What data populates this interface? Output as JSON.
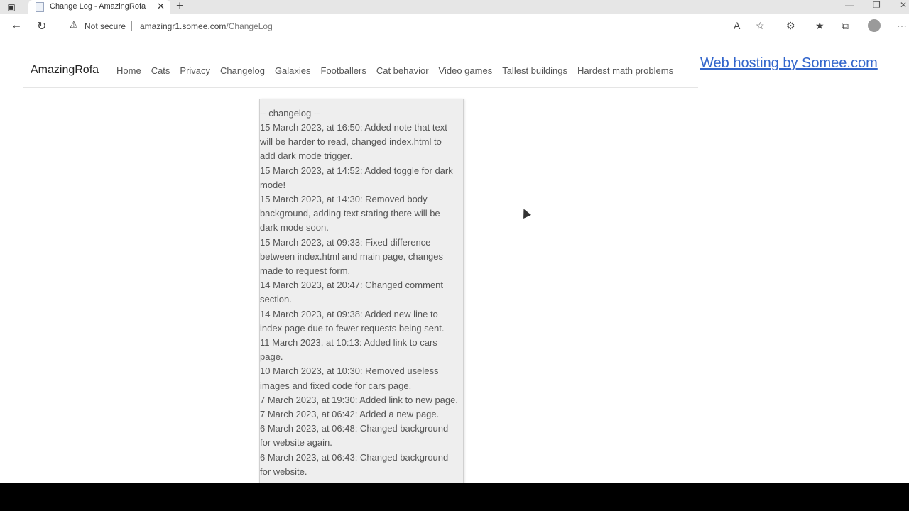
{
  "browser": {
    "tab_title": "Change Log - AmazingRofa",
    "not_secure": "Not secure",
    "url_host": "amazingr1.somee.com",
    "url_path": "/ChangeLog"
  },
  "site": {
    "brand": "AmazingRofa",
    "nav": [
      "Home",
      "Cats",
      "Privacy",
      "Changelog",
      "Galaxies",
      "Footballers",
      "Cat behavior",
      "Video games",
      "Tallest buildings",
      "Hardest math problems"
    ],
    "host_link": "Web hosting by Somee.com"
  },
  "changelog": {
    "header": "-- changelog --",
    "entries": [
      "15 March 2023, at 16:50: Added note that text will be harder to read, changed index.html to add dark mode trigger.",
      "15 March 2023, at 14:52: Added toggle for dark mode!",
      "15 March 2023, at 14:30: Removed body background, adding text stating there will be dark mode soon.",
      "15 March 2023, at 09:33: Fixed difference between index.html and main page, changes made to request form.",
      "14 March 2023, at 20:47: Changed comment section.",
      "14 March 2023, at 09:38: Added new line to index page due to fewer requests being sent.",
      "11 March 2023, at 10:13: Added link to cars page.",
      "10 March 2023, at 10:30: Removed useless images and fixed code for cars page.",
      "7 March 2023, at 19:30: Added link to new page.",
      "7 March 2023, at 06:42: Added a new page.",
      "6 March 2023, at 06:48: Changed background for website again.",
      "6 March 2023, at 06:43: Changed background for website."
    ]
  }
}
